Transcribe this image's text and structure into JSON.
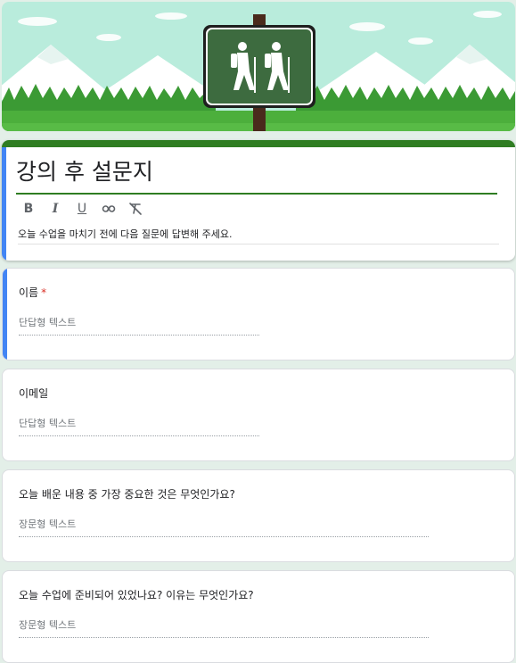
{
  "banner": {
    "image": "hiking-trail-sign-banner",
    "sky_color": "#b9ecdc",
    "grass_color": "#4caf3c",
    "sign_color": "#3d6b3f"
  },
  "form": {
    "title": "강의 후 설문지",
    "description": "오늘 수업을 마치기 전에 다음 질문에 답변해 주세요.",
    "theme_color": "#2f7d22",
    "toolbar": {
      "bold": "B",
      "italic": "I",
      "underline": "U",
      "link_icon": "link-icon",
      "clear_format_icon": "clear-format-icon"
    }
  },
  "questions": [
    {
      "label": "이름",
      "required": "*",
      "answer_placeholder": "단답형 텍스트"
    },
    {
      "label": "이메일",
      "answer_placeholder": "단답형 텍스트"
    },
    {
      "label": "오늘 배운 내용 중 가장 중요한 것은 무엇인가요?",
      "answer_placeholder": "장문형 텍스트"
    },
    {
      "label": "오늘 수업에 준비되어 있었나요?  이유는 무엇인가요?",
      "answer_placeholder": "장문형 텍스트"
    }
  ]
}
